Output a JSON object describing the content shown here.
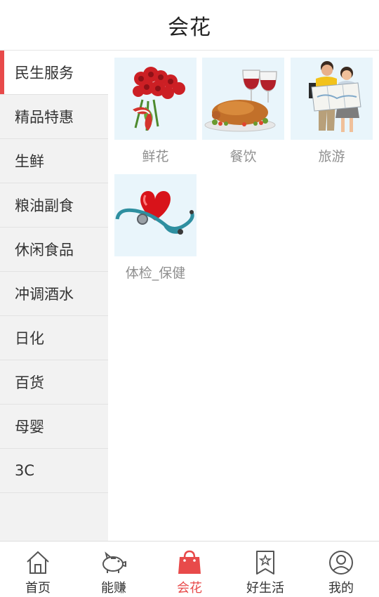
{
  "header": {
    "title": "会花"
  },
  "sidebar": {
    "items": [
      {
        "label": "民生服务",
        "active": true
      },
      {
        "label": "精品特惠",
        "active": false
      },
      {
        "label": "生鲜",
        "active": false
      },
      {
        "label": "粮油副食",
        "active": false
      },
      {
        "label": "休闲食品",
        "active": false
      },
      {
        "label": "冲调酒水",
        "active": false
      },
      {
        "label": "日化",
        "active": false
      },
      {
        "label": "百货",
        "active": false
      },
      {
        "label": "母婴",
        "active": false
      },
      {
        "label": "3C",
        "active": false
      }
    ]
  },
  "content": {
    "tiles": [
      {
        "label": "鲜花",
        "icon": "roses-image"
      },
      {
        "label": "餐饮",
        "icon": "roast-chicken-wine-image"
      },
      {
        "label": "旅游",
        "icon": "tourists-map-image"
      },
      {
        "label": "体检_保健",
        "icon": "heart-stethoscope-image"
      }
    ]
  },
  "tabbar": {
    "items": [
      {
        "label": "首页",
        "icon": "home-icon",
        "active": false
      },
      {
        "label": "能赚",
        "icon": "piggy-bank-icon",
        "active": false
      },
      {
        "label": "会花",
        "icon": "shopping-bag-icon",
        "active": true
      },
      {
        "label": "好生活",
        "icon": "bookmark-star-icon",
        "active": false
      },
      {
        "label": "我的",
        "icon": "user-icon",
        "active": false
      }
    ]
  },
  "colors": {
    "accent": "#e84a4a",
    "sidebar_bg": "#f2f2f2",
    "thumb_bg": "#e9f5fb",
    "label_gray": "#8f8f8f"
  }
}
